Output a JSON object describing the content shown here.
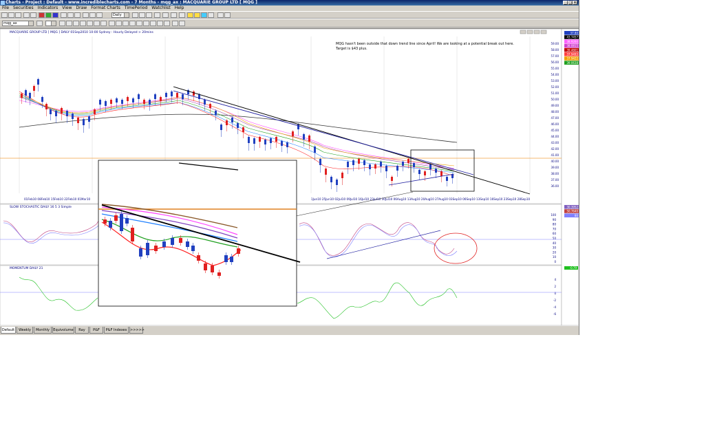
{
  "window": {
    "title": "Charts - Project : Default - www.incrediblecharts.com - 7 Months - mqg_ax : MACQUARIE GROUP LTD [ MQG ]"
  },
  "menu": [
    "File",
    "Securities",
    "Indicators",
    "View",
    "Draw",
    "Format Charts",
    "TimePeriod",
    "Watchlist",
    "Help"
  ],
  "toolbar": {
    "symbol_value": "mqg_ax",
    "period_value": "Daily"
  },
  "chart": {
    "header": "MACQUARIE GROUP LTD [ MQG ] DAILY 01Sep2010 10:00 Sydney : Hourly Delayed > 20mins",
    "annotation_lines": [
      "MQG hasn't been outside that down trend line since April!  We are looking at a potential break out here.",
      "Target is $43 plus."
    ],
    "price_ticks": [
      "59.00",
      "58.00",
      "57.00",
      "56.00",
      "55.00",
      "54.00",
      "53.00",
      "52.00",
      "51.00",
      "50.00",
      "49.00",
      "48.00",
      "47.00",
      "46.00",
      "45.00",
      "44.00",
      "43.00",
      "42.00",
      "41.00",
      "40.00",
      "39.00",
      "38.00",
      "37.00",
      "36.00"
    ],
    "price_badges": [
      {
        "text": "37.80",
        "color": "#2040c0"
      },
      {
        "text": "43.7457",
        "color": "#000000"
      },
      {
        "text": "38.9260",
        "color": "#ff60ff"
      },
      {
        "text": "38.0815",
        "color": "#d040d0"
      },
      {
        "text": "39.4801",
        "color": "#c00000"
      },
      {
        "text": "37.9493",
        "color": "#ff4040"
      },
      {
        "text": "37.9422",
        "color": "#f0a000"
      },
      {
        "text": "39.0638",
        "color": "#20a020"
      }
    ],
    "date_labels_left": "01Feb10 08Feb10 15Feb10 22Feb10 01Mar10",
    "date_labels_right": "1Jun10 25Jun10 02Jul10 09Jul10 16Jul10 23Jul10 30Jul10 06Aug10 13Aug10 20Aug10 27Aug10 03Sep10 06Sep10 13Sep10 16Sep10 23Sep10 28Sep10"
  },
  "stochastic": {
    "label": "SLOW STOCHASTIC DAILY 16 5 3 Simple",
    "ticks": [
      "100",
      "90",
      "80",
      "70",
      "60",
      "50",
      "40",
      "30",
      "20",
      "10",
      "0"
    ],
    "badges": [
      {
        "text": "30.3952",
        "color": "#8060c0"
      },
      {
        "text": "50.7640",
        "color": "#c04040"
      },
      {
        "text": "80",
        "color": "#8080ff"
      }
    ]
  },
  "momentum": {
    "label": "MOMENTUM DAILY 21",
    "ticks": [
      "4",
      "2",
      "0",
      "-2",
      "-4",
      "-6"
    ],
    "badge": {
      "text": "-0.79",
      "color": "#20c020"
    }
  },
  "tabs": [
    "Default",
    "Weekly",
    "Monthly",
    "Equivolume",
    "Ray",
    "P&F",
    "P&F Indexes",
    ">>>>>"
  ]
}
